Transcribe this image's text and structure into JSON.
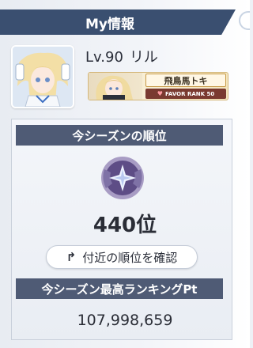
{
  "header": {
    "title": "My情報"
  },
  "profile": {
    "level": "Lv.90",
    "name": "リル",
    "partner_name": "飛鳥馬トキ",
    "favor_rank": "FAVOR RANK 50"
  },
  "season": {
    "rank_title": "今シーズンの順位",
    "rank_value": "440位",
    "check_button": "付近の順位を確認",
    "best_title": "今シーズン最高ランキングPt",
    "best_points": "107,998,659"
  },
  "icons": {
    "emblem": "rank-emblem-icon",
    "button_arrow": "share-arrow-icon",
    "favor_heart": "heart-icon"
  },
  "colors": {
    "header": "#3a4f70",
    "section_bar": "#4f5b75",
    "favor_badge": "#7a3a30"
  }
}
